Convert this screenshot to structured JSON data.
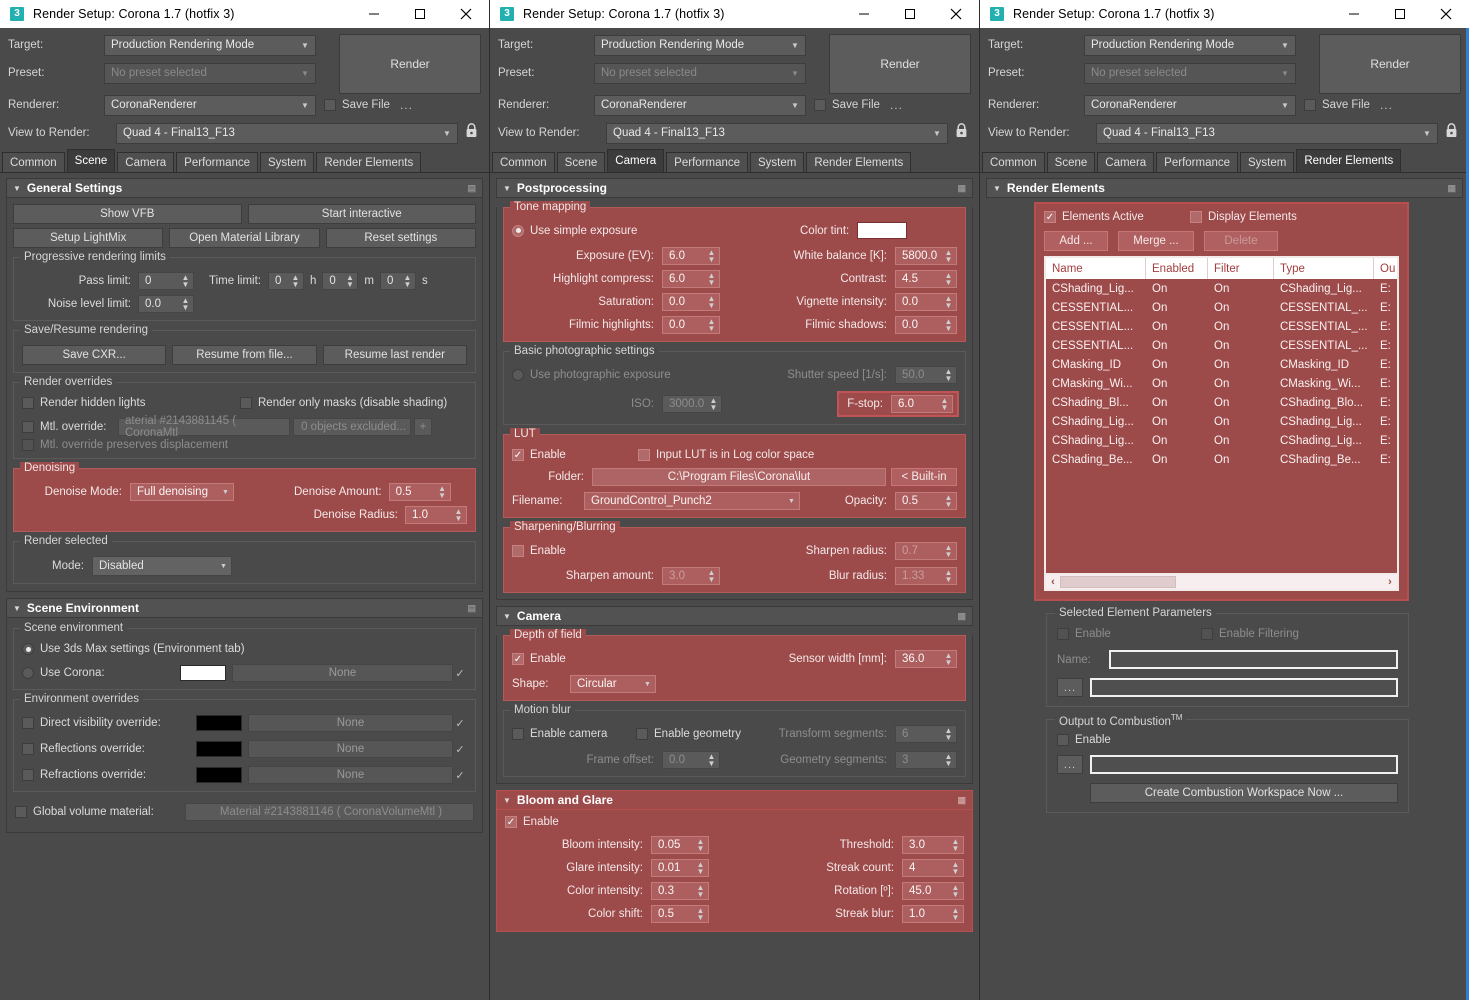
{
  "window": {
    "icon_label": "3",
    "title": "Render Setup: Corona 1.7 (hotfix 3)",
    "minimize_icon": "minimize-icon",
    "maximize_icon": "maximize-icon",
    "close_icon": "close-icon"
  },
  "top": {
    "target_label": "Target:",
    "target_value": "Production Rendering Mode",
    "preset_label": "Preset:",
    "preset_value": "No preset selected",
    "renderer_label": "Renderer:",
    "renderer_value": "CoronaRenderer",
    "view_label": "View to Render:",
    "view_value": "Quad 4 - Final13_F13",
    "render_button": "Render",
    "save_file_label": "Save File",
    "dots_label": "...",
    "lock_icon": "lock-icon"
  },
  "tabs": [
    "Common",
    "Scene",
    "Camera",
    "Performance",
    "System",
    "Render Elements"
  ],
  "active_tab": {
    "panel1": "Scene",
    "panel2": "Camera",
    "panel3": "Render Elements"
  },
  "panel1": {
    "general": {
      "title": "General Settings",
      "show_vfb": "Show VFB",
      "start_interactive": "Start interactive",
      "setup_lightmix": "Setup LightMix",
      "open_material_library": "Open Material Library",
      "reset_settings": "Reset settings",
      "progressive_caption": "Progressive rendering limits",
      "pass_limit_label": "Pass limit:",
      "pass_limit_value": "0",
      "time_limit_label": "Time limit:",
      "time_h_value": "0",
      "time_h_unit": "h",
      "time_m_value": "0",
      "time_m_unit": "m",
      "time_s_value": "0",
      "time_s_unit": "s",
      "noise_label": "Noise level limit:",
      "noise_value": "0.0",
      "saveresume_caption": "Save/Resume rendering",
      "save_cxr": "Save CXR...",
      "resume_from_file": "Resume from file...",
      "resume_last_render": "Resume last render",
      "overrides_caption": "Render overrides",
      "render_hidden_lights": "Render hidden lights",
      "render_only_masks": "Render only masks (disable shading)",
      "mtl_override_label": "Mtl. override:",
      "mtl_override_value": "aterial #2143881145  ( CoronaMtl",
      "mtl_excluded_value": "0 objects excluded...",
      "plus_label": "+",
      "mtl_preserves": "Mtl. override preserves displacement",
      "denoising_caption": "Denoising",
      "denoise_mode_label": "Denoise Mode:",
      "denoise_mode_value": "Full denoising",
      "denoise_amount_label": "Denoise Amount:",
      "denoise_amount_value": "0.5",
      "denoise_radius_label": "Denoise Radius:",
      "denoise_radius_value": "1.0",
      "render_selected_caption": "Render selected",
      "mode_label": "Mode:",
      "mode_value": "Disabled"
    },
    "environment": {
      "title": "Scene Environment",
      "scene_env_caption": "Scene environment",
      "use_3dsmax": "Use 3ds Max settings (Environment tab)",
      "use_corona": "Use Corona:",
      "none_label": "None",
      "overrides_caption": "Environment overrides",
      "direct_visibility": "Direct visibility override:",
      "reflections": "Reflections override:",
      "refractions": "Refractions override:",
      "global_volume_label": "Global volume material:",
      "global_volume_value": "Material #2143881146  ( CoronaVolumeMtl )"
    }
  },
  "panel2": {
    "postprocessing": {
      "title": "Postprocessing",
      "tone_caption": "Tone mapping",
      "use_simple_exposure": "Use simple exposure",
      "color_tint_label": "Color tint:",
      "exposure_label": "Exposure (EV):",
      "exposure_value": "6.0",
      "white_balance_label": "White balance [K]:",
      "white_balance_value": "5800.0",
      "highlight_label": "Highlight compress:",
      "highlight_value": "6.0",
      "contrast_label": "Contrast:",
      "contrast_value": "4.5",
      "saturation_label": "Saturation:",
      "saturation_value": "0.0",
      "vignette_label": "Vignette intensity:",
      "vignette_value": "0.0",
      "filmic_hi_label": "Filmic highlights:",
      "filmic_hi_value": "0.0",
      "filmic_sh_label": "Filmic shadows:",
      "filmic_sh_value": "0.0",
      "basic_caption": "Basic photographic settings",
      "use_photographic": "Use photographic exposure",
      "shutter_label": "Shutter speed [1/s]:",
      "shutter_value": "50.0",
      "iso_label": "ISO:",
      "iso_value": "3000.0",
      "fstop_label": "F-stop:",
      "fstop_value": "6.0",
      "lut_caption": "LUT",
      "lut_enable": "Enable",
      "lut_log": "Input LUT is in Log color space",
      "folder_label": "Folder:",
      "folder_value": "C:\\Program Files\\Corona\\lut",
      "builtin_label": "< Built-in",
      "filename_label": "Filename:",
      "filename_value": "GroundControl_Punch2",
      "opacity_label": "Opacity:",
      "opacity_value": "0.5",
      "sharp_caption": "Sharpening/Blurring",
      "sharp_enable": "Enable",
      "sharpen_radius_label": "Sharpen radius:",
      "sharpen_radius_value": "0.7",
      "sharpen_amount_label": "Sharpen amount:",
      "sharpen_amount_value": "3.0",
      "blur_radius_label": "Blur radius:",
      "blur_radius_value": "1.33"
    },
    "camera": {
      "title": "Camera",
      "dof_caption": "Depth of field",
      "dof_enable": "Enable",
      "sensor_label": "Sensor width [mm]:",
      "sensor_value": "36.0",
      "shape_label": "Shape:",
      "shape_value": "Circular",
      "motion_caption": "Motion blur",
      "enable_camera": "Enable camera",
      "enable_geometry": "Enable geometry",
      "transform_label": "Transform segments:",
      "transform_value": "6",
      "frame_offset_label": "Frame offset:",
      "frame_offset_value": "0.0",
      "geometry_label": "Geometry segments:",
      "geometry_value": "3"
    },
    "bloom": {
      "title": "Bloom and Glare",
      "enable": "Enable",
      "bloom_label": "Bloom intensity:",
      "bloom_value": "0.05",
      "threshold_label": "Threshold:",
      "threshold_value": "3.0",
      "glare_label": "Glare intensity:",
      "glare_value": "0.01",
      "streak_count_label": "Streak count:",
      "streak_count_value": "4",
      "color_intensity_label": "Color intensity:",
      "color_intensity_value": "0.3",
      "rotation_label": "Rotation [º]:",
      "rotation_value": "45.0",
      "color_shift_label": "Color shift:",
      "color_shift_value": "0.5",
      "streak_blur_label": "Streak blur:",
      "streak_blur_value": "1.0"
    }
  },
  "panel3": {
    "render_elements": {
      "title": "Render Elements",
      "elements_active": "Elements Active",
      "display_elements": "Display Elements",
      "add_button": "Add ...",
      "merge_button": "Merge ...",
      "delete_button": "Delete",
      "columns": [
        "Name",
        "Enabled",
        "Filter",
        "Type",
        "Ou"
      ],
      "rows": [
        {
          "name": "CShading_Lig...",
          "enabled": "On",
          "filter": "On",
          "type": "CShading_Lig...",
          "out": "E:"
        },
        {
          "name": "CESSENTIAL...",
          "enabled": "On",
          "filter": "On",
          "type": "CESSENTIAL_...",
          "out": "E:"
        },
        {
          "name": "CESSENTIAL...",
          "enabled": "On",
          "filter": "On",
          "type": "CESSENTIAL_...",
          "out": "E:"
        },
        {
          "name": "CESSENTIAL...",
          "enabled": "On",
          "filter": "On",
          "type": "CESSENTIAL_...",
          "out": "E:"
        },
        {
          "name": "CMasking_ID",
          "enabled": "On",
          "filter": "On",
          "type": "CMasking_ID",
          "out": "E:"
        },
        {
          "name": "CMasking_Wi...",
          "enabled": "On",
          "filter": "On",
          "type": "CMasking_Wi...",
          "out": "E:"
        },
        {
          "name": "CShading_Bl...",
          "enabled": "On",
          "filter": "On",
          "type": "CShading_Blo...",
          "out": "E:"
        },
        {
          "name": "CShading_Lig...",
          "enabled": "On",
          "filter": "On",
          "type": "CShading_Lig...",
          "out": "E:"
        },
        {
          "name": "CShading_Lig...",
          "enabled": "On",
          "filter": "On",
          "type": "CShading_Lig...",
          "out": "E:"
        },
        {
          "name": "CShading_Be...",
          "enabled": "On",
          "filter": "On",
          "type": "CShading_Be...",
          "out": "E:"
        }
      ],
      "scroll_left": "‹",
      "scroll_right": "›"
    },
    "selected_params": {
      "caption": "Selected Element Parameters",
      "enable": "Enable",
      "enable_filtering": "Enable Filtering",
      "name_label": "Name:",
      "browse_label": "..."
    },
    "combustion": {
      "caption_main": "Output to Combustion",
      "caption_sup": "TM",
      "enable": "Enable",
      "browse_label": "...",
      "create_workspace": "Create Combustion Workspace Now ..."
    }
  }
}
